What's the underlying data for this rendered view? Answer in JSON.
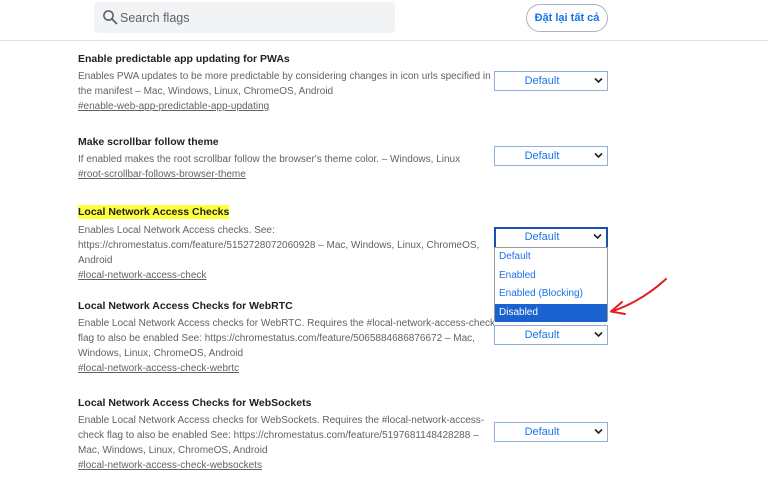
{
  "search": {
    "placeholder": "Search flags",
    "icon": "search-icon"
  },
  "header": {
    "reset_label": "Đặt lại tất cả"
  },
  "flags": [
    {
      "title": "Enable predictable app updating for PWAs",
      "description": "Enables PWA updates to be more predictable by considering changes in icon urls specified in the manifest – Mac, Windows, Linux, ChromeOS, Android",
      "link": "#enable-web-app-predictable-app-updating",
      "value": "Default"
    },
    {
      "title": "Make scrollbar follow theme",
      "description": "If enabled makes the root scrollbar follow the browser's theme color. – Windows, Linux",
      "link": "#root-scrollbar-follows-browser-theme",
      "value": "Default"
    },
    {
      "title": "Local Network Access Checks",
      "description": "Enables Local Network Access checks. See: https://chromestatus.com/feature/5152728072060928 – Mac, Windows, Linux, ChromeOS, Android",
      "link": "#local-network-access-check",
      "value": "Default",
      "highlighted": true
    },
    {
      "title": "Local Network Access Checks for WebRTC",
      "description": "Enable Local Network Access checks for WebRTC. Requires the #local-network-access-check flag to also be enabled See: https://chromestatus.com/feature/5065884686876672 – Mac, Windows, Linux, ChromeOS, Android",
      "link": "#local-network-access-check-webrtc",
      "value": "Default"
    },
    {
      "title": "Local Network Access Checks for WebSockets",
      "description": "Enable Local Network Access checks for WebSockets. Requires the #local-network-access-check flag to also be enabled See: https://chromestatus.com/feature/5197681148428288 – Mac, Windows, Linux, ChromeOS, Android",
      "link": "#local-network-access-check-websockets",
      "value": "Default"
    }
  ],
  "dropdown": {
    "options": [
      "Default",
      "Enabled",
      "Enabled (Blocking)",
      "Disabled"
    ],
    "selected_index": 3
  },
  "colors": {
    "accent": "#1a73e8",
    "highlight": "#ffff3c",
    "selected_option": "#1a62cf",
    "annotation_arrow": "#e02020"
  }
}
